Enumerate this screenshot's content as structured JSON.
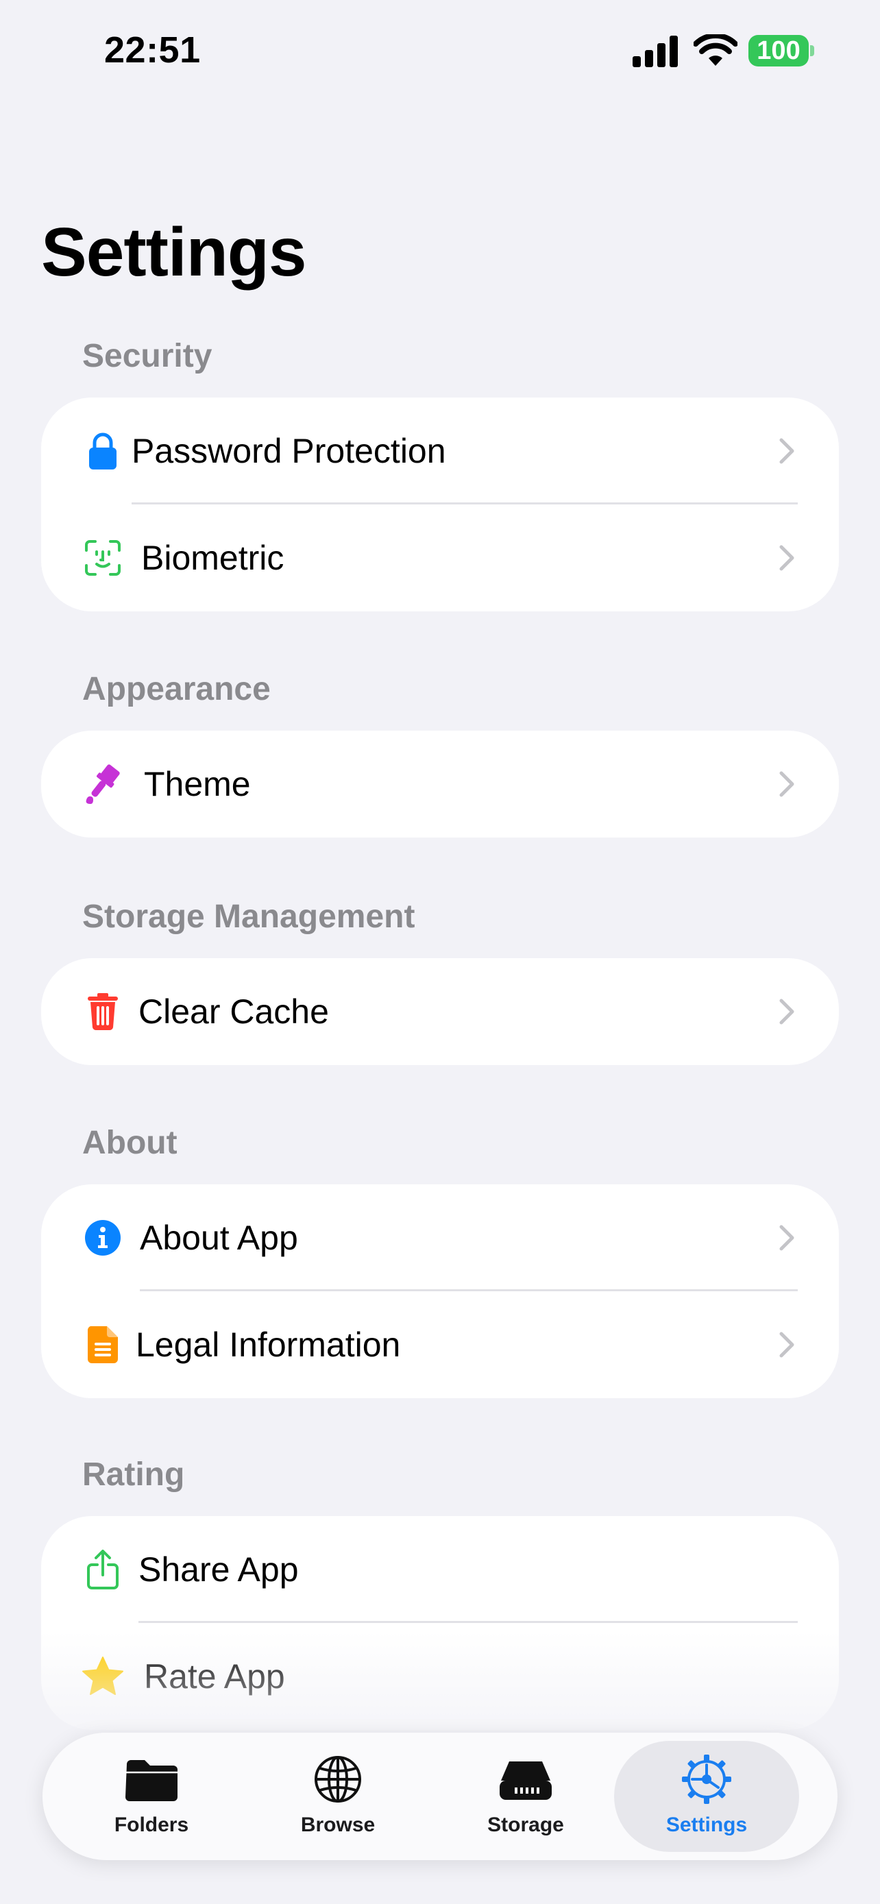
{
  "status_bar": {
    "time": "22:51",
    "battery": "100"
  },
  "page": {
    "title": "Settings"
  },
  "sections": [
    {
      "header": "Security",
      "items": [
        {
          "label": "Password Protection",
          "icon": "lock-icon",
          "color": "#0a84ff"
        },
        {
          "label": "Biometric",
          "icon": "face-id-icon",
          "color": "#34c759"
        }
      ]
    },
    {
      "header": "Appearance",
      "items": [
        {
          "label": "Theme",
          "icon": "paintbrush-icon",
          "color": "#c632d6"
        }
      ]
    },
    {
      "header": "Storage Management",
      "items": [
        {
          "label": "Clear Cache",
          "icon": "trash-icon",
          "color": "#ff3b30"
        }
      ]
    },
    {
      "header": "About",
      "items": [
        {
          "label": "About App",
          "icon": "info-icon",
          "color": "#0a84ff"
        },
        {
          "label": "Legal Information",
          "icon": "document-icon",
          "color": "#ff9500"
        }
      ]
    },
    {
      "header": "Rating",
      "items": [
        {
          "label": "Share App",
          "icon": "share-icon",
          "color": "#34c759"
        },
        {
          "label": "Rate App",
          "icon": "star-icon",
          "color": "#ffcc00"
        }
      ]
    }
  ],
  "tab_bar": {
    "active": "Settings",
    "accent": "#1a7ef0",
    "tabs": [
      {
        "label": "Folders",
        "icon": "folder-icon"
      },
      {
        "label": "Browse",
        "icon": "globe-icon"
      },
      {
        "label": "Storage",
        "icon": "drive-icon"
      },
      {
        "label": "Settings",
        "icon": "gear-icon"
      }
    ]
  }
}
